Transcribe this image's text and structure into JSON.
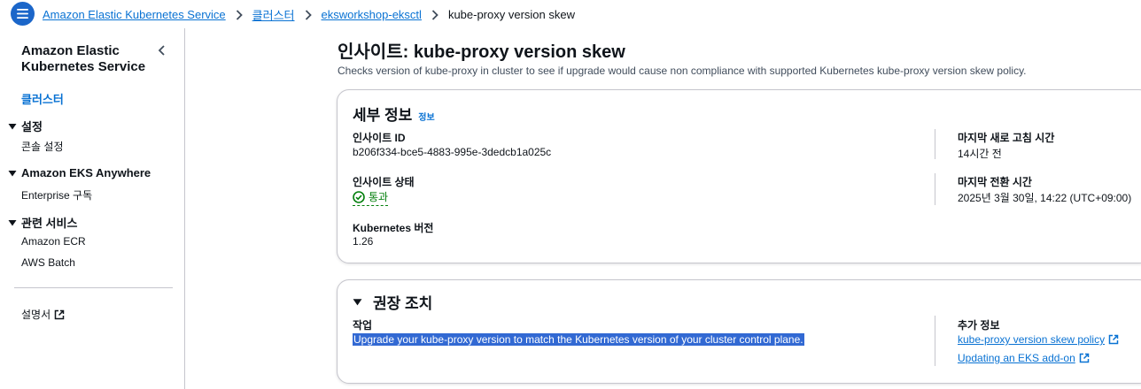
{
  "breadcrumb": {
    "items": [
      "Amazon Elastic Kubernetes Service",
      "클러스터",
      "eksworkshop-eksctl"
    ],
    "current": "kube-proxy version skew"
  },
  "sidebar": {
    "title": "Amazon Elastic Kubernetes Service",
    "active_link": "클러스터",
    "sections": [
      {
        "label": "설정",
        "items": [
          "콘솔 설정"
        ]
      },
      {
        "label": "Amazon EKS Anywhere",
        "items": [
          "Enterprise 구독"
        ]
      },
      {
        "label": "관련 서비스",
        "items": [
          "Amazon ECR",
          "AWS Batch"
        ]
      }
    ],
    "docs_link": "설명서"
  },
  "page": {
    "title": "인사이트: kube-proxy version skew",
    "description": "Checks version of kube-proxy in cluster to see if upgrade would cause non compliance with supported Kubernetes kube-proxy version skew policy."
  },
  "details": {
    "title": "세부 정보",
    "info_label": "정보",
    "insight_id_label": "인사이트 ID",
    "insight_id_value": "b206f334-bce5-4883-995e-3dedcb1a025c",
    "insight_status_label": "인사이트 상태",
    "insight_status_value": "통과",
    "k8s_version_label": "Kubernetes 버전",
    "k8s_version_value": "1.26",
    "last_refresh_label": "마지막 새로 고침 시간",
    "last_refresh_value": "14시간 전",
    "last_transition_label": "마지막 전환 시간",
    "last_transition_value": "2025년 3월 30일, 14:22 (UTC+09:00)"
  },
  "recommendation": {
    "title": "권장 조치",
    "task_label": "작업",
    "task_value": "Upgrade your kube-proxy version to match the Kubernetes version of your cluster control plane.",
    "more_info_label": "추가 정보",
    "links": [
      "kube-proxy version skew policy",
      "Updating an EKS add-on"
    ]
  },
  "colors": {
    "link": "#0972d3",
    "success": "#037f0c",
    "selection": "#3269d3",
    "menu_button": "#1b66c9"
  },
  "icons": [
    "menu-icon",
    "chevron-right-icon",
    "chevron-left-icon",
    "caret-down-icon",
    "external-link-icon",
    "status-success-icon"
  ]
}
